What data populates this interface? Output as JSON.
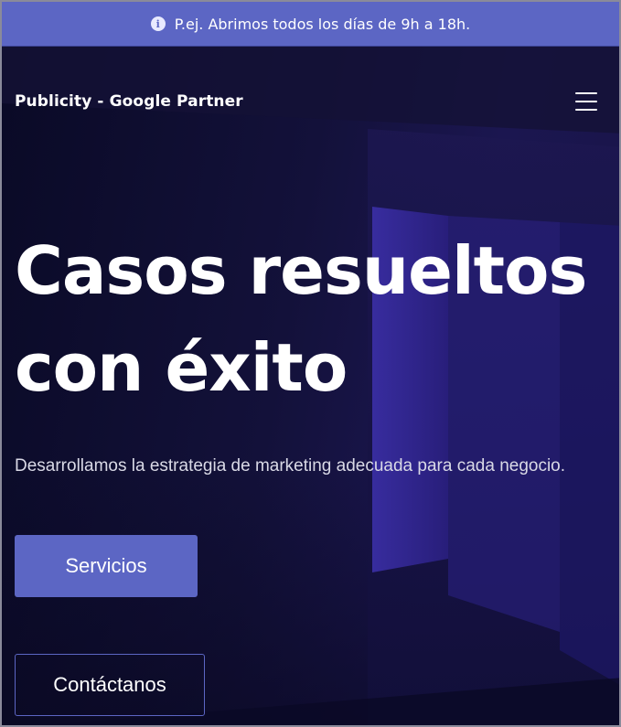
{
  "announcement": {
    "icon": "info-icon",
    "text": "P.ej. Abrimos todos los días de 9h a 18h."
  },
  "header": {
    "site_title": "Publicity - Google Partner",
    "menu_icon": "hamburger-menu-icon"
  },
  "hero": {
    "headline": "Casos resueltos con éxito",
    "subtitle": "Desarrollamos la estrategia de marketing adecuada para cada negocio.",
    "primary_button": "Servicios",
    "secondary_button": "Contáctanos"
  },
  "colors": {
    "accent": "#5c66c4",
    "background": "#0c0b28",
    "text": "#ffffff"
  }
}
